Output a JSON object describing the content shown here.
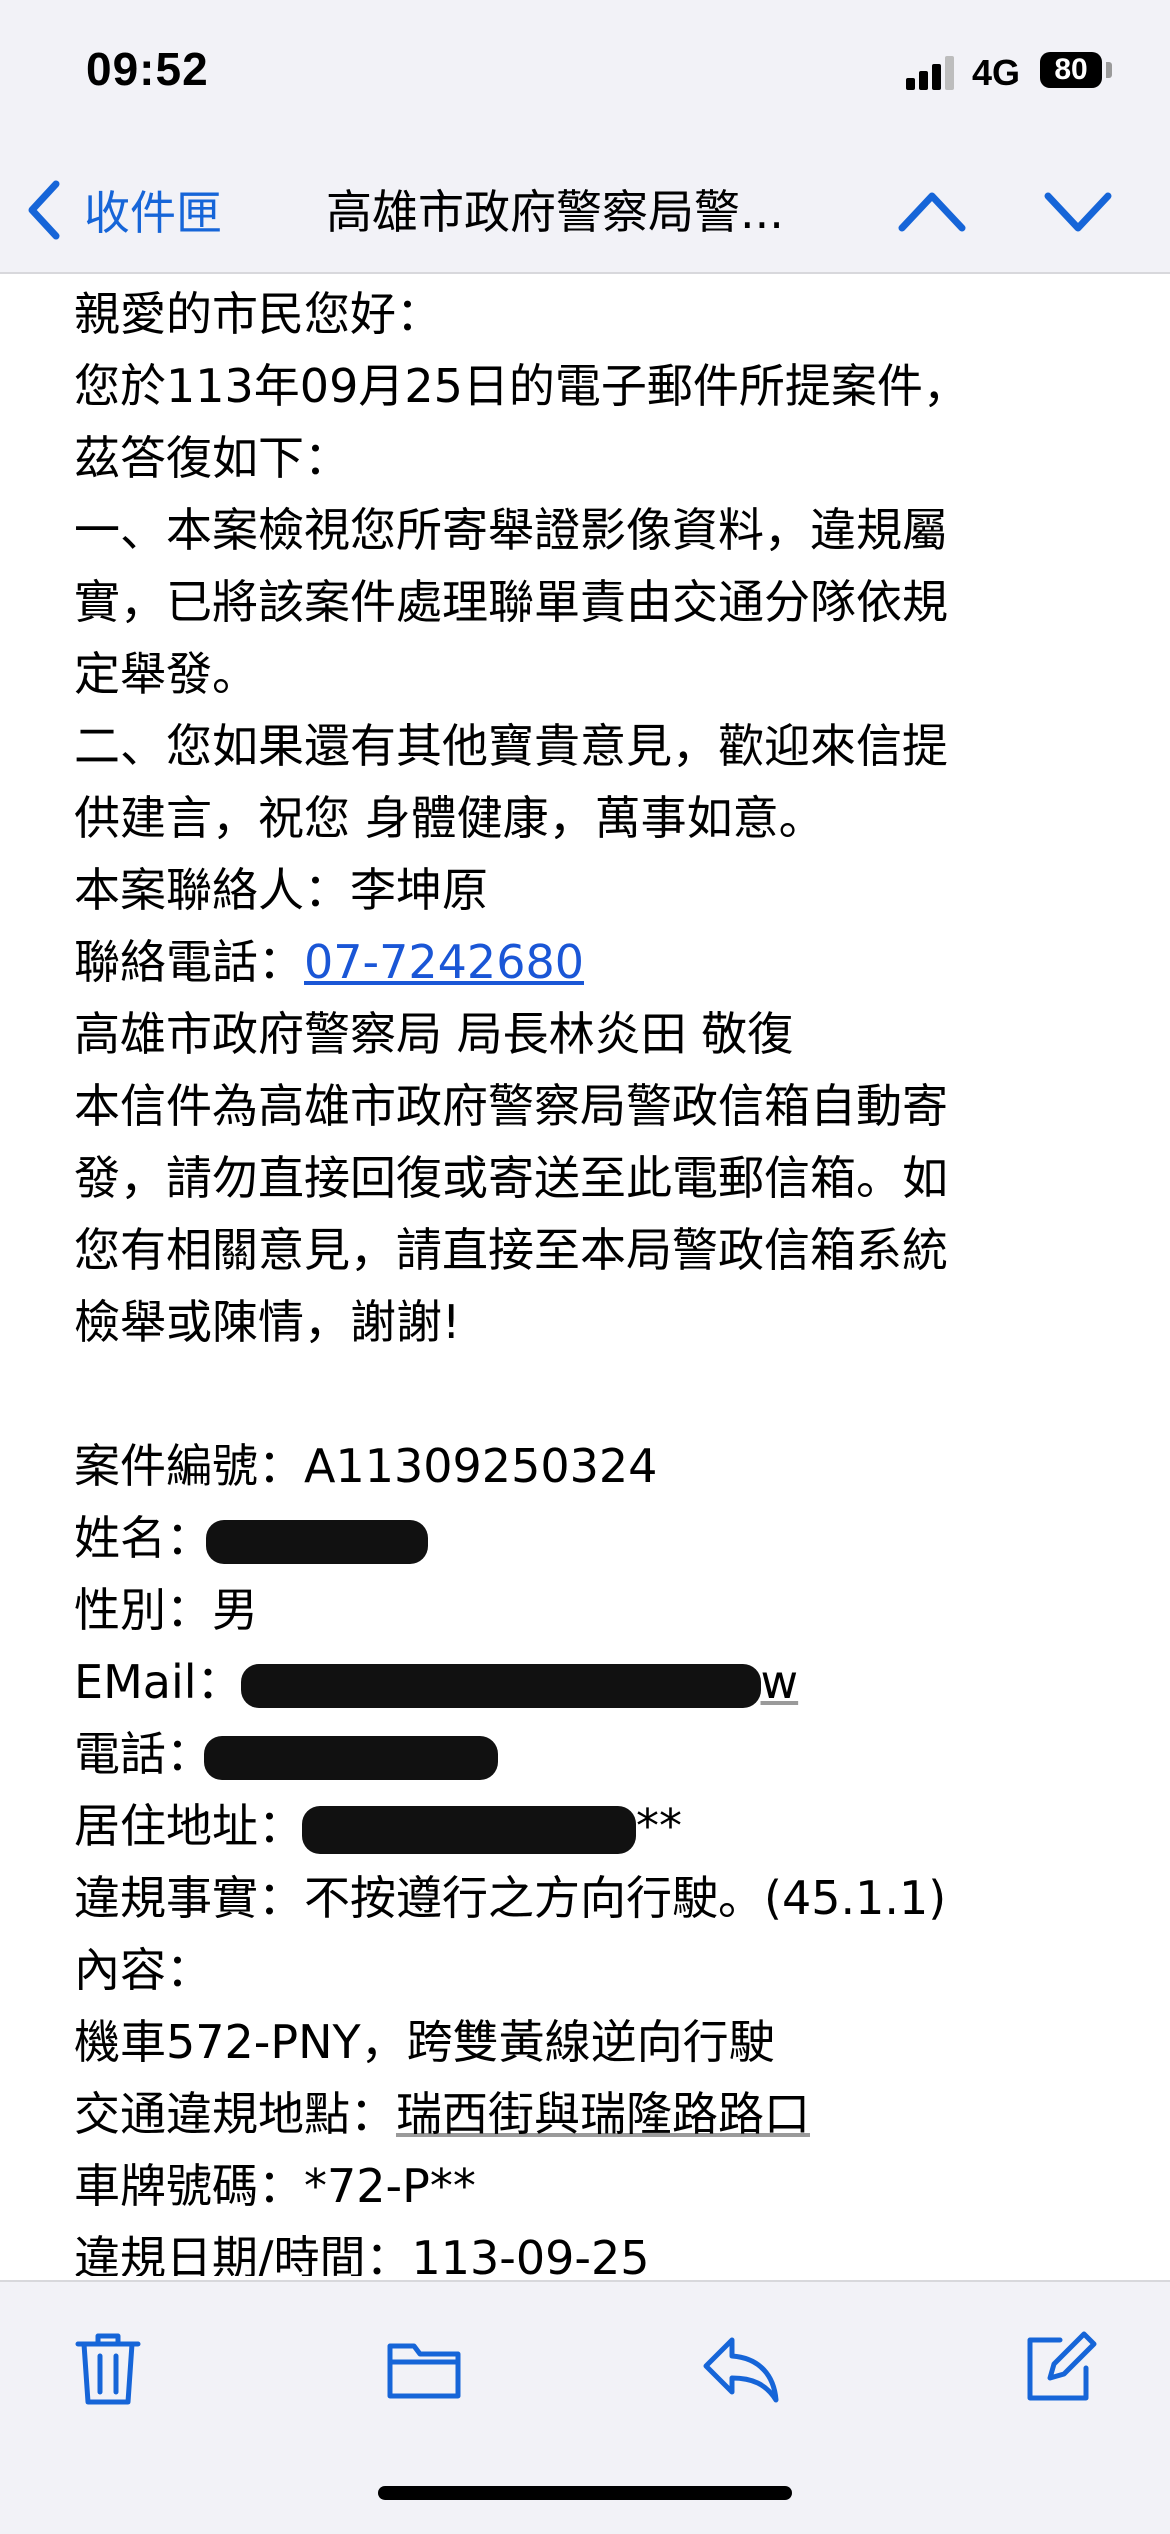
{
  "status": {
    "time": "09:52",
    "network": "4G",
    "battery": "80"
  },
  "nav": {
    "back_label": "收件匣",
    "title": "高雄市政府警察局警..."
  },
  "email": {
    "greeting": "親愛的市民您好：",
    "intro_1": "您於113年09月25日的電子郵件所提案件，",
    "intro_2": "茲答復如下：",
    "p1_1": "一、本案檢視您所寄舉證影像資料，違規屬",
    "p1_2": "實，已將該案件處理聯單責由交通分隊依規",
    "p1_3": "定舉發。",
    "p2_1": "二、您如果還有其他寶貴意見，歡迎來信提",
    "p2_2": "供建言，祝您 身體健康，萬事如意。",
    "contact_person": "本案聯絡人：李坤原",
    "contact_phone_label": "聯絡電話：",
    "contact_phone": "07-7242680",
    "signature": "高雄市政府警察局 局長林炎田 敬復",
    "notice_1": "本信件為高雄市政府警察局警政信箱自動寄",
    "notice_2": "發，請勿直接回復或寄送至此電郵信箱。如",
    "notice_3": "您有相關意見，請直接至本局警政信箱系統",
    "notice_4": "檢舉或陳情，謝謝!",
    "case_no": "案件編號：A11309250324",
    "name_label": "姓名：",
    "gender": "性別：男",
    "email_label": "EMail：",
    "email_tail": "w",
    "phone_label": "電話：",
    "address_label": "居住地址：",
    "address_tail": "**",
    "violation": "違規事實：不按遵行之方向行駛。(45.1.1)",
    "content_label": "內容：",
    "content_text": "機車572-PNY，跨雙黃線逆向行駛",
    "location_label": "交通違規地點：",
    "location": "瑞西街與瑞隆路路口",
    "plate": "車牌號碼：*72-P**",
    "datetime_label": "違規日期/時間：",
    "datetime": "113-09-25"
  },
  "colors": {
    "accent": "#1665d8",
    "link": "#1a56d6",
    "bar_bg": "#f2f2f7"
  },
  "icons": {
    "back": "chevron-left-icon",
    "up": "chevron-up-icon",
    "down": "chevron-down-icon",
    "trash": "trash-icon",
    "folder": "folder-icon",
    "reply": "reply-icon",
    "compose": "compose-icon"
  }
}
